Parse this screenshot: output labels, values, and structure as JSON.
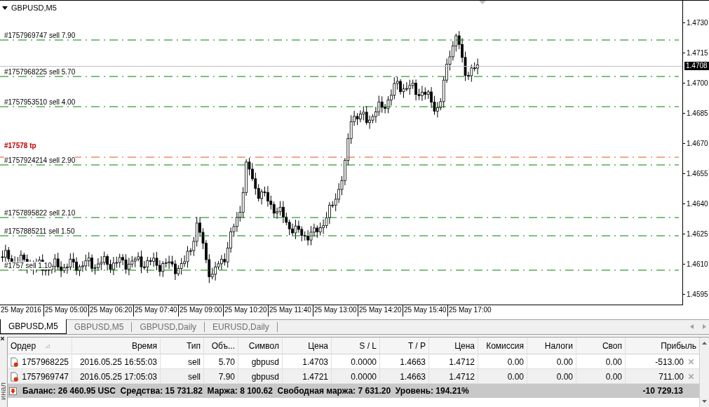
{
  "chart": {
    "title": "GBPUSD,M5",
    "current_price": "1.4708",
    "order_lines": [
      {
        "kind": "sell",
        "label": "#1757969747 sell 7.90"
      },
      {
        "kind": "sell",
        "label": "#1757968225 sell 5.70"
      },
      {
        "kind": "sell",
        "label": "#1757953510 sell 4.00"
      },
      {
        "kind": "tp",
        "label": "#17578 tp"
      },
      {
        "kind": "sell",
        "label": "#1757924214 sell 2.90"
      },
      {
        "kind": "sell",
        "label": "#1757895822 sell 2.10"
      },
      {
        "kind": "sell",
        "label": "#1757885211 sell 1.50"
      },
      {
        "kind": "sell",
        "label": "#1757 sell 1.10"
      }
    ],
    "price_ticks": [
      "1.4730",
      "1.4715",
      "1.4700",
      "1.4685",
      "1.4670",
      "1.4655",
      "1.4640",
      "1.4625",
      "1.4610",
      "1.4595"
    ],
    "time_ticks": [
      "25 May 2016",
      "25 May 05:00",
      "25 May 06:20",
      "25 May 07:40",
      "25 May 09:00",
      "25 May 10:20",
      "25 May 11:40",
      "25 May 13:00",
      "25 May 14:20",
      "25 May 15:40",
      "25 May 17:00"
    ]
  },
  "chart_tabs": [
    {
      "label": "GBPUSD,M5",
      "selected": true
    },
    {
      "label": "GBPUSD,M5",
      "selected": false
    },
    {
      "label": "GBPUSD,Daily",
      "selected": false
    },
    {
      "label": "EURUSD,Daily",
      "selected": false
    }
  ],
  "terminal": {
    "side_label": "инал",
    "columns": [
      "Ордер",
      "Время",
      "Тип",
      "Объ...",
      "Символ",
      "Цена",
      "S / L",
      "T / P",
      "Цена",
      "Комиссия",
      "Налоги",
      "Своп",
      "Прибыль"
    ],
    "rows": [
      [
        "1757968225",
        "2016.05.25 16:55:03",
        "sell",
        "5.70",
        "gbpusd",
        "1.4703",
        "0.0000",
        "1.4663",
        "1.4712",
        "0.00",
        "0.00",
        "0.00",
        "-513.00"
      ],
      [
        "1757969747",
        "2016.05.25 17:05:03",
        "sell",
        "7.90",
        "gbpusd",
        "1.4721",
        "0.0000",
        "1.4663",
        "1.4712",
        "0.00",
        "0.00",
        "0.00",
        "711.00"
      ]
    ],
    "summary": "Баланс: 26 460.95 USC  Средства: 15 731.82  Маржа: 8 100.62  Свободная маржа: 7 631.20  Уровень: 194.21%",
    "total_profit": "-10 729.13"
  }
}
